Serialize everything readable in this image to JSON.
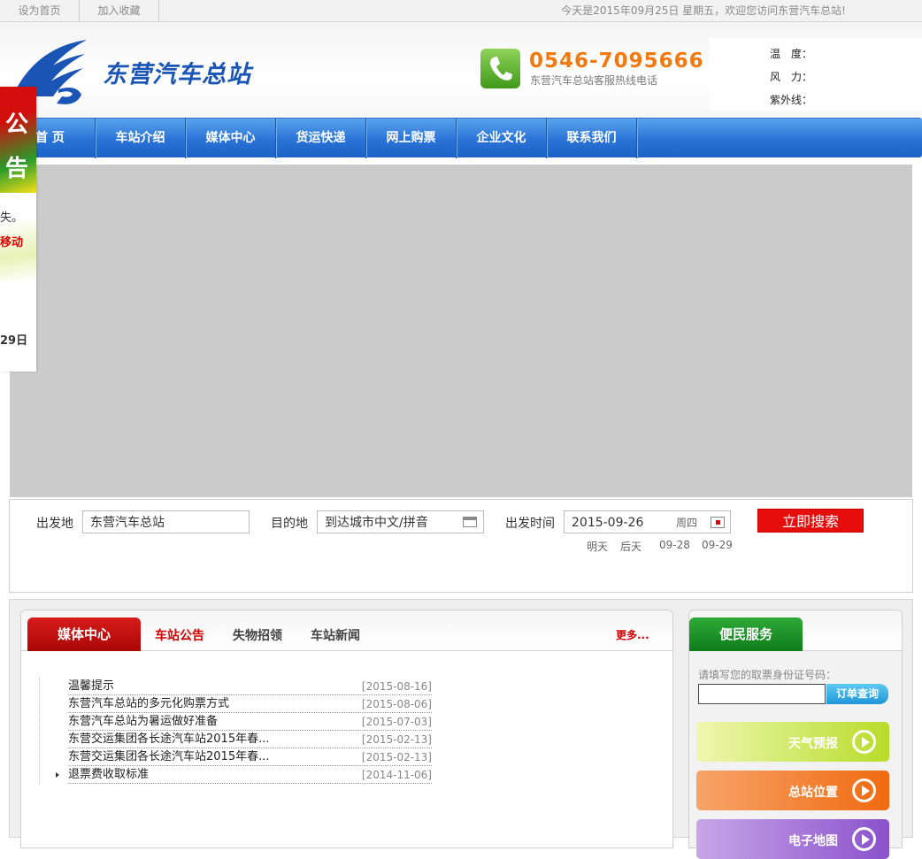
{
  "topbar": {
    "set_home": "设为首页",
    "add_favorite": "加入收藏",
    "welcome": "今天是2015年09月25日 星期五，欢迎您访问东营汽车总站!"
  },
  "header": {
    "site_name": "东营汽车总站",
    "hotline_number": "0546-7095666",
    "hotline_label": "东营汽车总站客服热线电话",
    "weather": {
      "temperature_label": "温　度：",
      "wind_label": "风　力：",
      "uv_label": "紫外线："
    }
  },
  "nav": {
    "items": [
      "首 页",
      "车站介绍",
      "媒体中心",
      "货运快递",
      "网上购票",
      "企业文化",
      "联系我们"
    ]
  },
  "search": {
    "depart_label": "出发地",
    "depart_value": "东营汽车总站",
    "dest_label": "目的地",
    "dest_placeholder": "到达城市中文/拼音",
    "time_label": "出发时间",
    "date_value": "2015-09-26",
    "weekday": "周四",
    "submit": "立即搜索",
    "quick_dates": [
      "明天",
      "后天",
      "09-28",
      "09-29"
    ]
  },
  "media": {
    "tab_main": "媒体中心",
    "tabs": [
      "车站公告",
      "失物招领",
      "车站新闻"
    ],
    "more": "更多...",
    "news": [
      {
        "title": "温馨提示",
        "date": "[2015-08-16]"
      },
      {
        "title": "东营汽车总站的多元化购票方式",
        "date": "[2015-08-06]"
      },
      {
        "title": "东营汽车总站为暑运做好准备",
        "date": "[2015-07-03]"
      },
      {
        "title": "东营交运集团各长途汽车站2015年春...",
        "date": "[2015-02-13]"
      },
      {
        "title": "东营交运集团各长途汽车站2015年春...",
        "date": "[2015-02-13]"
      },
      {
        "title": "退票费收取标准",
        "date": "[2014-11-06]"
      }
    ]
  },
  "service": {
    "title": "便民服务",
    "hint": "请填写您的取票身份证号码：",
    "query_button": "订单查询",
    "cards": [
      "天气预报",
      "总站位置",
      "电子地图"
    ]
  },
  "notice": {
    "title_1": "公",
    "title_2": "告",
    "line_1": "失。",
    "line_2": "移动",
    "line_3": "29日"
  },
  "colors": {
    "nav_blue": "#2a73d6",
    "brand_blue": "#1a55b5",
    "hotline_orange": "#f07a10",
    "search_red": "#e60d0d",
    "media_red": "#c80f0f",
    "service_green": "#1a8f25"
  }
}
